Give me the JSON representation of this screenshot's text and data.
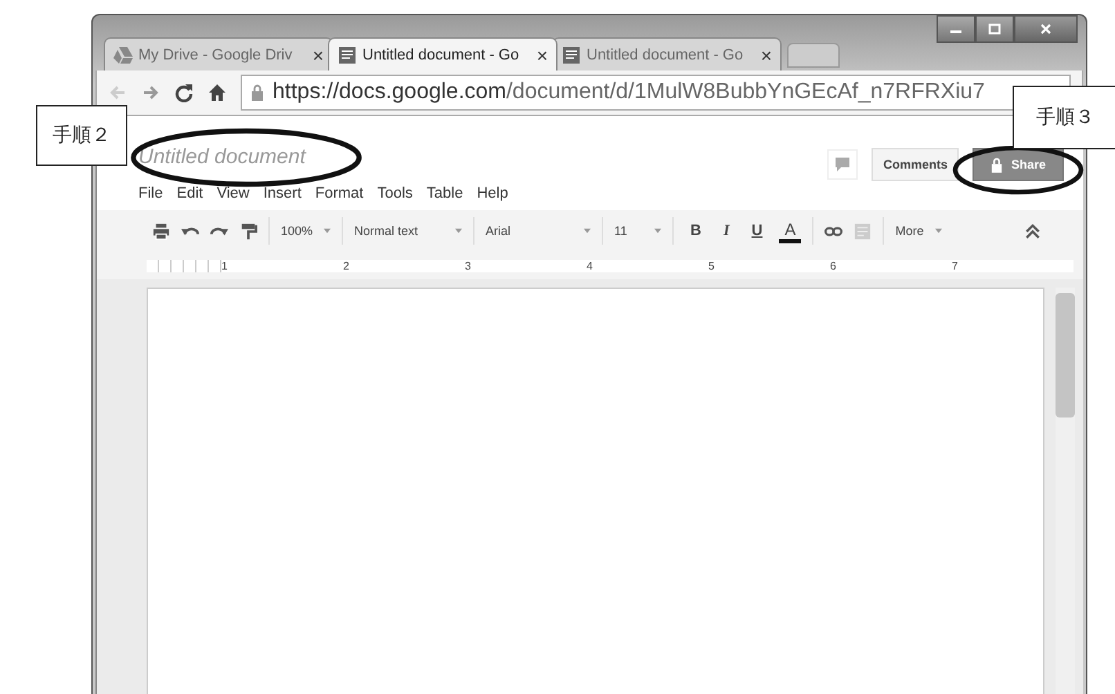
{
  "browser": {
    "tabs": [
      {
        "label": "My Drive - Google Driv",
        "selected": false
      },
      {
        "label": "Untitled document - Go",
        "selected": true
      },
      {
        "label": "Untitled document - Go",
        "selected": false
      }
    ],
    "close_glyph": "×",
    "url": {
      "host": "https://docs.google.com",
      "path": "/document/d/1MulW8BubbYnGEcAf_n7RFRXiu7"
    }
  },
  "document": {
    "title": "Untitled document",
    "menu": [
      "File",
      "Edit",
      "View",
      "Insert",
      "Format",
      "Tools",
      "Table",
      "Help"
    ],
    "comments_button": "Comments",
    "share_button": "Share",
    "toolbar": {
      "zoom": "100%",
      "style": "Normal text",
      "font": "Arial",
      "size": "11",
      "format_glyphs": [
        "B",
        "I",
        "U",
        "A"
      ],
      "more": "More"
    },
    "ruler": [
      "1",
      "2",
      "3",
      "4",
      "5",
      "6",
      "7"
    ]
  },
  "callouts": [
    {
      "label": "手順２"
    },
    {
      "label": "手順３"
    }
  ]
}
